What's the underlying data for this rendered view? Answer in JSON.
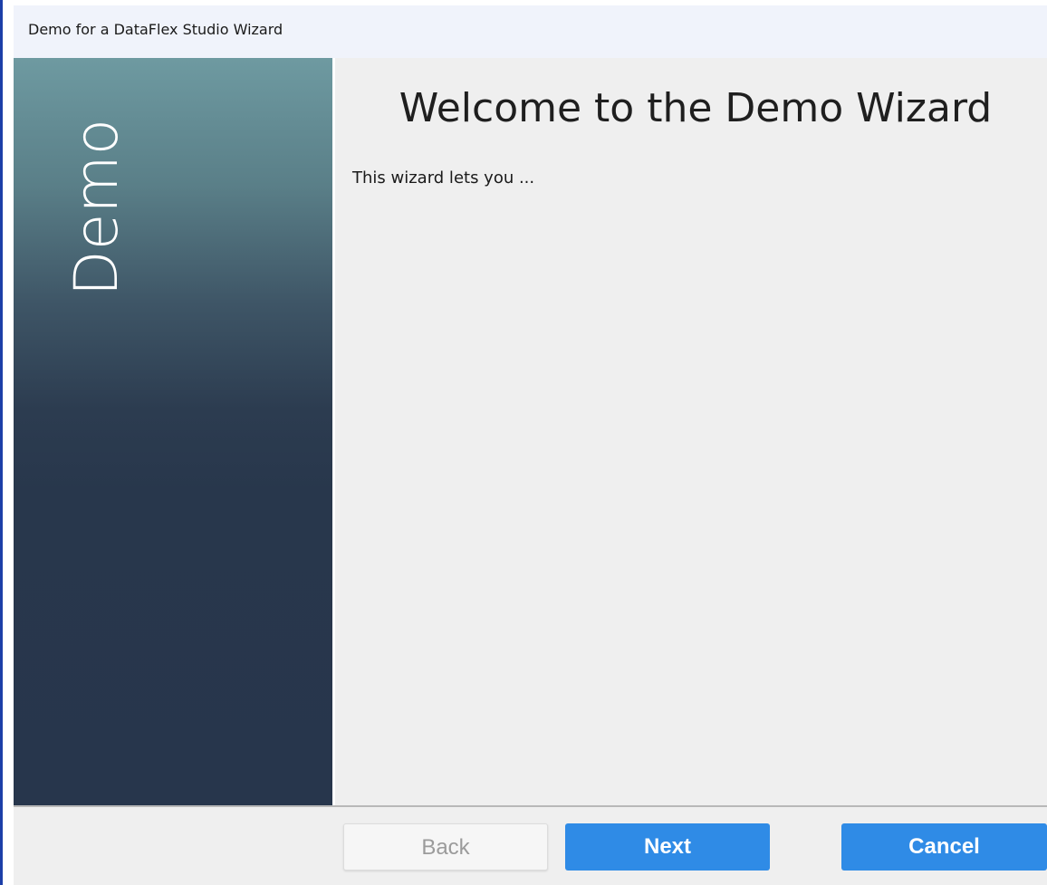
{
  "window": {
    "title": "Demo for a DataFlex Studio Wizard"
  },
  "sidebar": {
    "banner_text": "Demo"
  },
  "main": {
    "heading": "Welcome to the Demo Wizard",
    "description": "This wizard lets you ..."
  },
  "footer": {
    "back_label": "Back",
    "back_enabled": false,
    "next_label": "Next",
    "cancel_label": "Cancel"
  },
  "colors": {
    "accent": "#2f8be6",
    "sidebar_top": "#6e9aa1",
    "sidebar_bottom": "#27364c",
    "content_bg": "#efefef"
  }
}
